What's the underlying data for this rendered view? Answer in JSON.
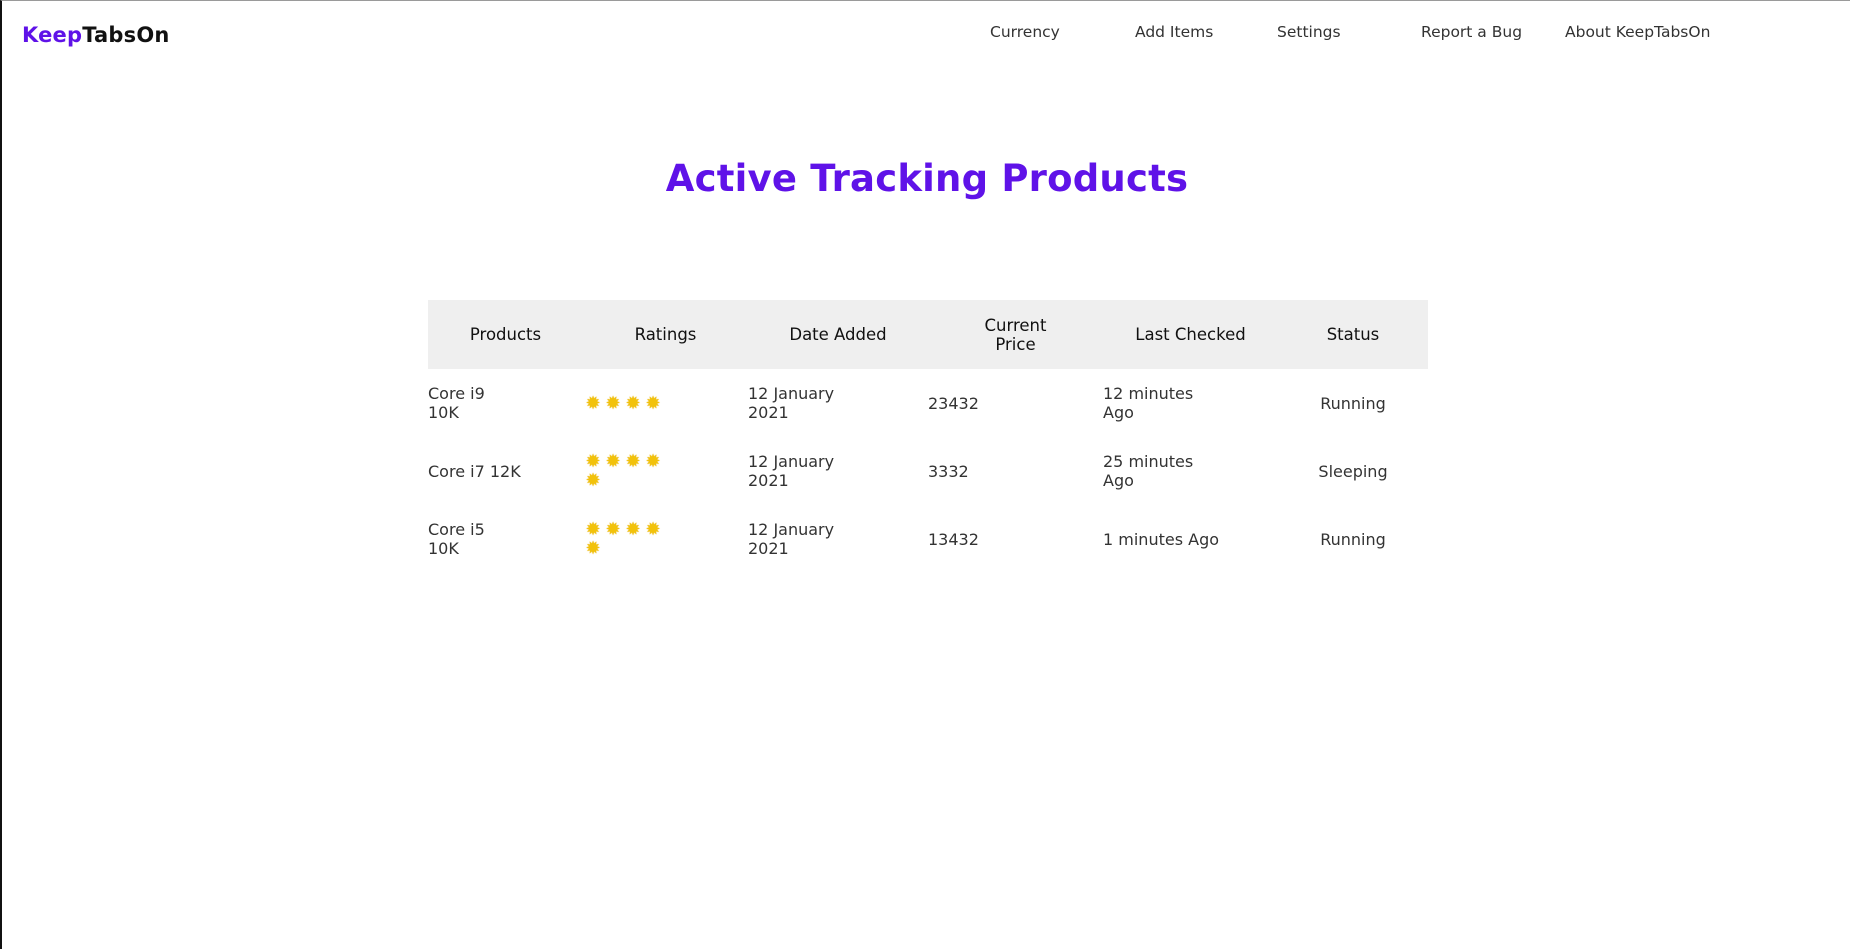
{
  "brand": {
    "part1": "Keep",
    "part2": "TabsOn",
    "accent_color": "#5f12e8"
  },
  "nav": [
    {
      "label": "Currency"
    },
    {
      "label": "Add Items"
    },
    {
      "label": "Settings"
    },
    {
      "label": "Report a Bug"
    },
    {
      "label": "About KeepTabsOn"
    }
  ],
  "page_title": "Active Tracking Products",
  "table": {
    "headers": [
      "Products",
      "Ratings",
      "Date Added",
      "Current Price",
      "Last Checked",
      "Status"
    ],
    "rows": [
      {
        "product": "Core i9 10K",
        "rating": 4,
        "rating_icon": "star-icon",
        "date_added": "12 January 2021",
        "current_price": "23432",
        "last_checked": "12 minutes Ago",
        "status": "Running"
      },
      {
        "product": "Core i7 12K",
        "rating": 5,
        "rating_icon": "star-icon",
        "date_added": "12 January 2021",
        "current_price": "3332",
        "last_checked": "25 minutes Ago",
        "status": "Sleeping"
      },
      {
        "product": "Core i5 10K",
        "rating": 5,
        "rating_icon": "star-icon",
        "date_added": "12 January 2021",
        "current_price": "13432",
        "last_checked": "1 minutes Ago",
        "status": "Running"
      }
    ]
  }
}
